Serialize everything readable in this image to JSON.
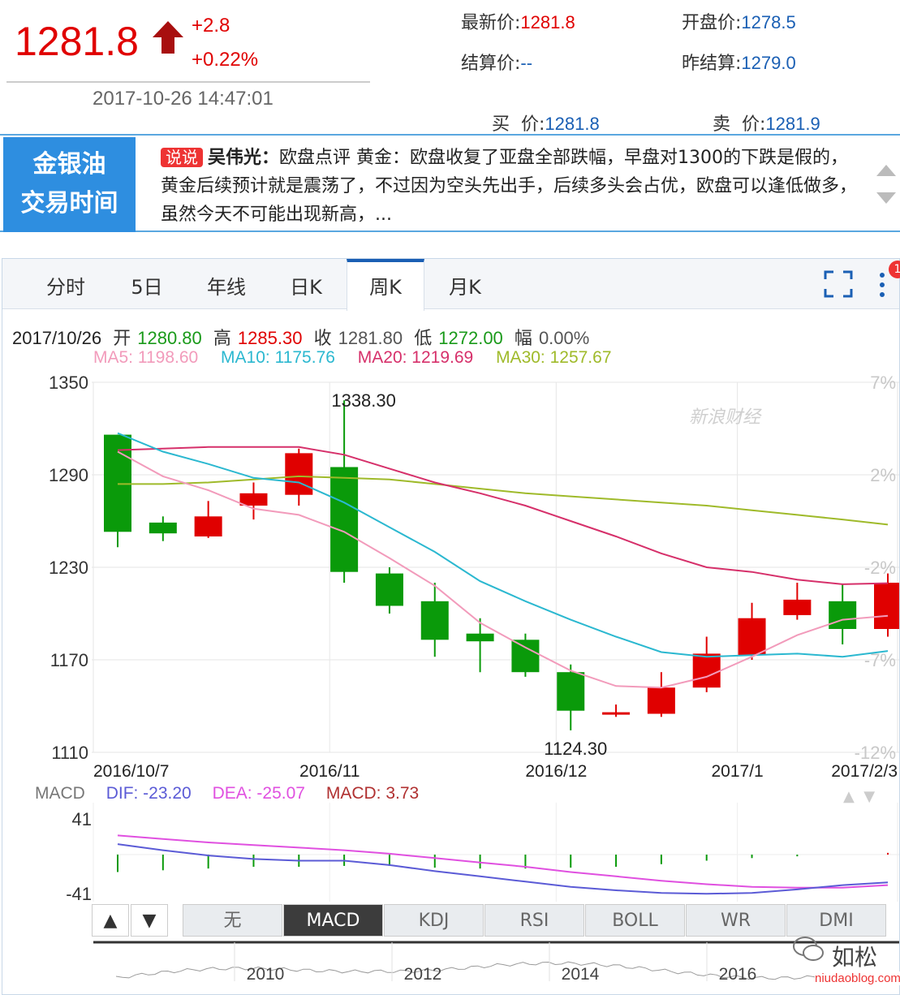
{
  "quote": {
    "price": "1281.8",
    "change": "+2.8",
    "change_pct": "+0.22%",
    "timestamp": "2017-10-26 14:47:01",
    "fields": [
      {
        "label": "最新价:",
        "value": "1281.8",
        "color": "red"
      },
      {
        "label": "开盘价:",
        "value": "1278.5",
        "color": "blue"
      },
      {
        "label": "结算价:",
        "value": "--",
        "color": "blue"
      },
      {
        "label": "昨结算:",
        "value": "1279.0",
        "color": "blue"
      },
      {
        "label": "买  价:",
        "value": "1281.8",
        "color": "blue"
      },
      {
        "label": "卖  价:",
        "value": "1281.9",
        "color": "blue"
      }
    ]
  },
  "banner": {
    "badge_line1": "金银油",
    "badge_line2": "交易时间",
    "tag": "说说",
    "author": "吴伟光：",
    "text": "欧盘点评 黄金：欧盘收复了亚盘全部跌幅，早盘对1300的下跌是假的，黄金后续预计就是震荡了，不过因为空头先出手，后续多头会占优，欧盘可以逢低做多，虽然今天不可能出现新高，..."
  },
  "tabs": [
    "分时",
    "5日",
    "年线",
    "日K",
    "周K",
    "月K"
  ],
  "active_tab": "周K",
  "notify_count": "1",
  "ohlc": {
    "date": "2017/10/26",
    "open_label": "开",
    "open": "1280.80",
    "high_label": "高",
    "high": "1285.30",
    "close_label": "收",
    "close": "1281.80",
    "low_label": "低",
    "low": "1272.00",
    "amp_label": "幅",
    "amp": "0.00%"
  },
  "ma_legend": {
    "ma5": "MA5: 1198.60",
    "ma10": "MA10: 1175.76",
    "ma20": "MA20: 1219.69",
    "ma30": "MA30: 1257.67"
  },
  "colors": {
    "up": "#e00000",
    "down": "#0a9a0a",
    "ma5": "#f29bbb",
    "ma10": "#2bb8d0",
    "ma20": "#d6306a",
    "ma30": "#9fba2a",
    "dif": "#5b5bd6",
    "dea": "#e050e0",
    "macd": "#b03030"
  },
  "watermark": "新浪财经",
  "chart_data": {
    "type": "candlestick",
    "y_ticks": [
      "1350",
      "1290",
      "1230",
      "1170",
      "1110"
    ],
    "y_range": [
      1110,
      1350
    ],
    "pct_ticks": [
      "7%",
      "2%",
      "-2%",
      "-7%",
      "-12%"
    ],
    "x_labels": [
      "2016/10/7",
      "2016/11",
      "2016/12",
      "2017/1",
      "2017/2/3"
    ],
    "annotations": {
      "max": "1338.30",
      "min": "1124.30"
    },
    "candles": [
      {
        "o": 1316,
        "c": 1253,
        "h": 1316,
        "l": 1243
      },
      {
        "o": 1259,
        "c": 1252,
        "h": 1263,
        "l": 1247
      },
      {
        "o": 1250,
        "c": 1263,
        "h": 1273,
        "l": 1249
      },
      {
        "o": 1270,
        "c": 1278,
        "h": 1285,
        "l": 1261
      },
      {
        "o": 1277,
        "c": 1304,
        "h": 1307,
        "l": 1270
      },
      {
        "o": 1295,
        "c": 1227,
        "h": 1338.3,
        "l": 1220
      },
      {
        "o": 1226,
        "c": 1205,
        "h": 1230,
        "l": 1200
      },
      {
        "o": 1208,
        "c": 1183,
        "h": 1220,
        "l": 1172
      },
      {
        "o": 1187,
        "c": 1182,
        "h": 1197,
        "l": 1162
      },
      {
        "o": 1183,
        "c": 1162,
        "h": 1187,
        "l": 1159
      },
      {
        "o": 1162,
        "c": 1137,
        "h": 1167,
        "l": 1124.3
      },
      {
        "o": 1136,
        "c": 1136,
        "h": 1141,
        "l": 1133
      },
      {
        "o": 1135,
        "c": 1152,
        "h": 1162,
        "l": 1133
      },
      {
        "o": 1152,
        "c": 1174,
        "h": 1185,
        "l": 1149
      },
      {
        "o": 1173,
        "c": 1197,
        "h": 1207,
        "l": 1170
      },
      {
        "o": 1199,
        "c": 1209,
        "h": 1220,
        "l": 1196
      },
      {
        "o": 1208,
        "c": 1190,
        "h": 1219,
        "l": 1180
      },
      {
        "o": 1190,
        "c": 1220,
        "h": 1226,
        "l": 1185
      }
    ],
    "ma5": [
      1305,
      1289,
      1280,
      1268,
      1264,
      1253,
      1236,
      1218,
      1194,
      1178,
      1163,
      1153,
      1152,
      1159,
      1172,
      1186,
      1196,
      1198.6
    ],
    "ma10": [
      1317,
      1305,
      1297,
      1288,
      1285,
      1272,
      1256,
      1240,
      1221,
      1208,
      1196,
      1185,
      1175,
      1172,
      1173,
      1174,
      1172,
      1175.76
    ],
    "ma20": [
      1306,
      1307,
      1308,
      1308,
      1308,
      1303,
      1294,
      1285,
      1278,
      1270,
      1260,
      1250,
      1239,
      1230,
      1227,
      1222,
      1219,
      1219.69
    ],
    "ma30": [
      1284,
      1284,
      1285,
      1287,
      1289,
      1288,
      1287,
      1284,
      1281,
      1278,
      1276,
      1274,
      1272,
      1270,
      1267,
      1264,
      1261,
      1257.67
    ],
    "macd_panel": {
      "legend_label": "MACD",
      "dif_label": "DIF: -23.20",
      "dea_label": "DEA: -25.07",
      "macd_label": "MACD: 3.73",
      "y_ticks": [
        "41",
        "-41"
      ],
      "y_range": [
        -41,
        41
      ],
      "dif": [
        12,
        5,
        -1,
        -5,
        -7,
        -7,
        -12,
        -19,
        -25,
        -31,
        -37,
        -41,
        -44,
        -45,
        -44,
        -40,
        -35,
        -32
      ],
      "dea": [
        22,
        18,
        14,
        11,
        8,
        5,
        1,
        -4,
        -9,
        -14,
        -20,
        -25,
        -30,
        -34,
        -37,
        -38,
        -38,
        -35
      ],
      "hist": [
        -20,
        -18,
        -16,
        -14,
        -14,
        -13,
        -13,
        -15,
        -16,
        -16,
        -15,
        -14,
        -11,
        -7,
        -4,
        -2,
        0,
        2
      ]
    },
    "indicators": [
      "无",
      "MACD",
      "KDJ",
      "RSI",
      "BOLL",
      "WR",
      "DMI"
    ],
    "active_indicator": "MACD",
    "overview_years": [
      "2010",
      "2012",
      "2014",
      "2016"
    ]
  },
  "brand": "如松",
  "site": "niudaoblog.com"
}
